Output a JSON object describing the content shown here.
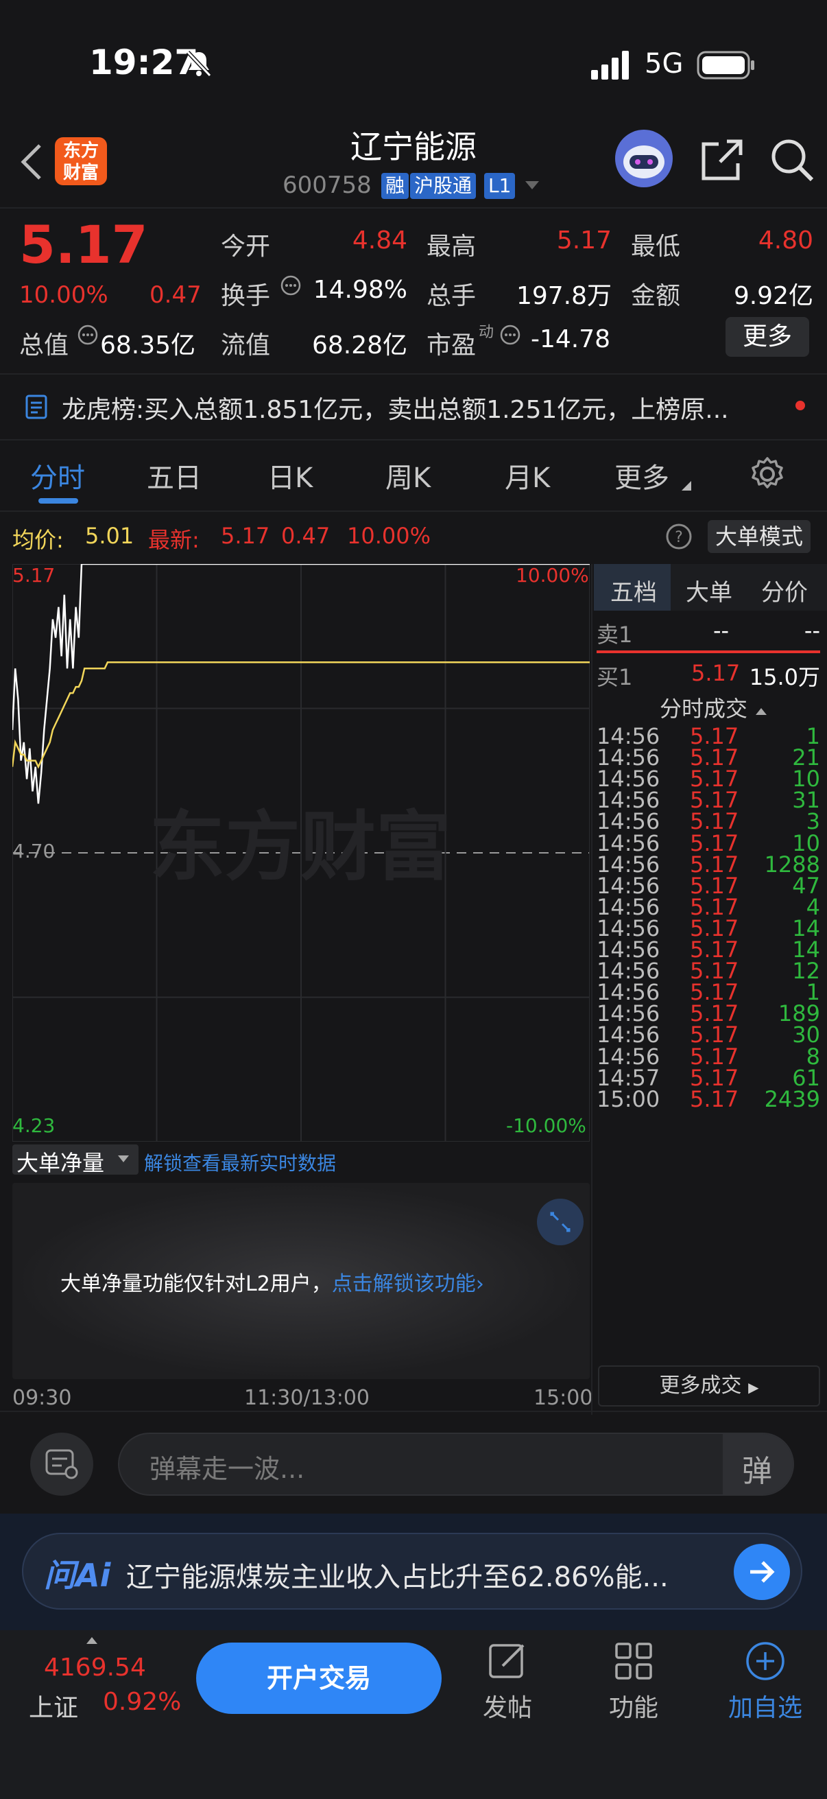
{
  "status": {
    "time": "19:27",
    "network": "5G"
  },
  "header": {
    "logo_line1": "东方",
    "logo_line2": "财富",
    "title": "辽宁能源",
    "code": "600758",
    "tags": [
      "融",
      "沪股通",
      "L1"
    ]
  },
  "quote": {
    "price": "5.17",
    "pct": "10.00%",
    "change": "0.47",
    "open_label": "今开",
    "open": "4.84",
    "high_label": "最高",
    "high": "5.17",
    "low_label": "最低",
    "low": "4.80",
    "turnover_label": "换手",
    "turnover": "14.98%",
    "volume_label": "总手",
    "volume": "197.8万",
    "amount_label": "金额",
    "amount": "9.92亿",
    "mktcap_label": "总值",
    "mktcap": "68.35亿",
    "float_label": "流值",
    "float": "68.28亿",
    "pe_label": "市盈",
    "pe_sup": "动",
    "pe": "-14.78",
    "more": "更多"
  },
  "dragon_tiger": {
    "label": "龙虎榜:",
    "text": "买入总额1.851亿元，卖出总额1.251亿元，上榜原..."
  },
  "tabs": [
    "分时",
    "五日",
    "日K",
    "周K",
    "月K",
    "更多"
  ],
  "chart_header": {
    "avg_label": "均价:",
    "avg": "5.01",
    "latest_label": "最新:",
    "latest": "5.17",
    "latest_change": "0.47",
    "latest_pct": "10.00%",
    "big_order_mode": "大单模式"
  },
  "chart_data": {
    "type": "line",
    "y_top": "5.17",
    "y_mid": "4.70",
    "y_bottom": "4.23",
    "pct_top": "10.00%",
    "pct_bottom": "-10.00%",
    "ylim": [
      4.23,
      5.17
    ],
    "x_labels": [
      "09:30",
      "11:30/13:00",
      "15:00"
    ],
    "watermark": "东方财富",
    "series": [
      {
        "color": "#ffffff",
        "values": [
          4.9,
          5.0,
          4.95,
          4.85,
          4.88,
          4.82,
          4.87,
          4.8,
          4.84,
          4.78,
          4.83,
          4.9,
          4.95,
          5.0,
          5.08,
          5.05,
          5.1,
          5.02,
          5.12,
          5.0,
          5.08,
          5.0,
          5.1,
          5.05,
          5.17,
          5.17,
          5.17,
          5.17,
          5.17,
          5.17,
          5.17,
          5.17,
          5.17,
          5.17,
          5.17,
          5.17,
          5.17,
          5.17,
          5.17,
          5.17
        ]
      },
      {
        "color": "#f2d65a",
        "values": [
          4.84,
          4.88,
          4.87,
          4.86,
          4.86,
          4.85,
          4.85,
          4.85,
          4.85,
          4.84,
          4.85,
          4.86,
          4.87,
          4.88,
          4.9,
          4.91,
          4.92,
          4.93,
          4.94,
          4.95,
          4.96,
          4.96,
          4.97,
          4.97,
          4.98,
          5.0,
          5.0,
          5.0,
          5.0,
          5.0,
          5.0,
          5.0,
          5.0,
          5.01,
          5.01,
          5.01,
          5.01,
          5.01,
          5.01,
          5.01
        ]
      }
    ]
  },
  "net_panel": {
    "selector": "大单净量",
    "unlock": "解锁查看最新实时数据",
    "notice": "大单净量功能仅针对L2用户，",
    "notice_link": "点击解锁该功能"
  },
  "right_panel": {
    "tabs": [
      "五档",
      "大单",
      "分价"
    ],
    "sell1_label": "卖1",
    "sell1_price": "--",
    "sell1_vol": "--",
    "buy1_label": "买1",
    "buy1_price": "5.17",
    "buy1_vol": "15.0万",
    "trades_title": "分时成交",
    "trades": [
      {
        "time": "14:56",
        "price": "5.17",
        "vol": "1"
      },
      {
        "time": "14:56",
        "price": "5.17",
        "vol": "21"
      },
      {
        "time": "14:56",
        "price": "5.17",
        "vol": "10"
      },
      {
        "time": "14:56",
        "price": "5.17",
        "vol": "31"
      },
      {
        "time": "14:56",
        "price": "5.17",
        "vol": "3"
      },
      {
        "time": "14:56",
        "price": "5.17",
        "vol": "10"
      },
      {
        "time": "14:56",
        "price": "5.17",
        "vol": "1288"
      },
      {
        "time": "14:56",
        "price": "5.17",
        "vol": "47"
      },
      {
        "time": "14:56",
        "price": "5.17",
        "vol": "4"
      },
      {
        "time": "14:56",
        "price": "5.17",
        "vol": "14"
      },
      {
        "time": "14:56",
        "price": "5.17",
        "vol": "14"
      },
      {
        "time": "14:56",
        "price": "5.17",
        "vol": "12"
      },
      {
        "time": "14:56",
        "price": "5.17",
        "vol": "1"
      },
      {
        "time": "14:56",
        "price": "5.17",
        "vol": "189"
      },
      {
        "time": "14:56",
        "price": "5.17",
        "vol": "30"
      },
      {
        "time": "14:56",
        "price": "5.17",
        "vol": "8"
      },
      {
        "time": "14:57",
        "price": "5.17",
        "vol": "61"
      },
      {
        "time": "15:00",
        "price": "5.17",
        "vol": "2439"
      }
    ],
    "more_trades": "更多成交"
  },
  "danmaku": {
    "placeholder": "弹幕走一波...",
    "button": "弹"
  },
  "ai_bar": {
    "logo": "问Ai",
    "text": "辽宁能源煤炭主业收入占比升至62.86%能..."
  },
  "bottom": {
    "index_value": "4169.54",
    "index_name": "上证",
    "index_pct": "0.92%",
    "open_trade": "开户交易",
    "post": "发帖",
    "functions": "功能",
    "add_watch": "加自选"
  }
}
